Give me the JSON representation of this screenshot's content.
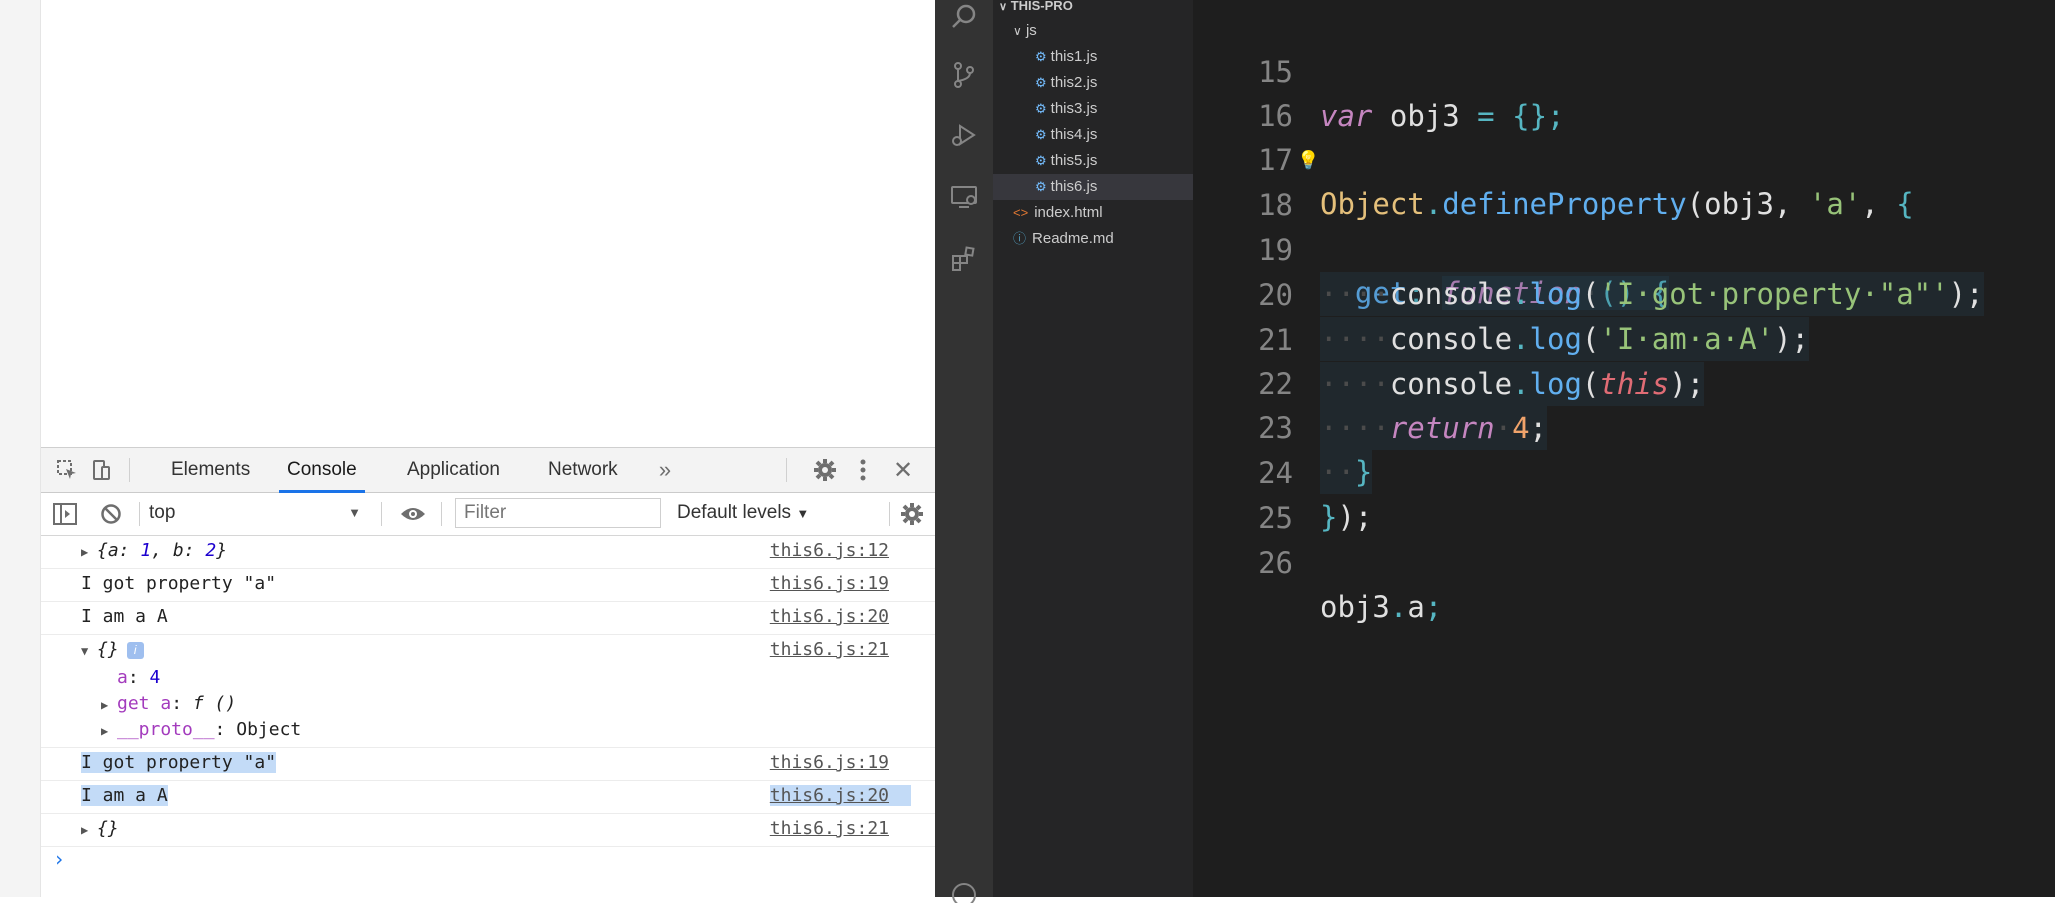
{
  "devtools": {
    "tabs": [
      "Elements",
      "Console",
      "Application",
      "Network"
    ],
    "more_tabs_icon": "chevron-double-right-icon",
    "context_select": "top",
    "filter_placeholder": "Filter",
    "levels_label": "Default levels",
    "console_rows": [
      {
        "source": "this6.js:12"
      },
      {
        "message": "I got property \"a\"",
        "source": "this6.js:19"
      },
      {
        "message": "I am a A",
        "source": "this6.js:20"
      },
      {
        "source": "this6.js:21"
      },
      {
        "message": "I got property \"a\"",
        "source": "this6.js:19"
      },
      {
        "message": "I am a A",
        "source": "this6.js:20"
      },
      {
        "source": "this6.js:21"
      }
    ],
    "object_preview": {
      "a": "1",
      "b": "2"
    },
    "expanded_props": {
      "a_value": "4",
      "getter_label": "get a",
      "getter_value": "f ()",
      "proto_label": "__proto__",
      "proto_value": "Object"
    },
    "colors": {
      "active_tab": "#1a73e8",
      "selection": "#c3dbf7"
    }
  },
  "vscode": {
    "explorer": {
      "folder": "THIS-PRO",
      "subfolder": "js",
      "files": [
        "this1.js",
        "this2.js",
        "this3.js",
        "this4.js",
        "this5.js",
        "this6.js"
      ],
      "root_files": [
        "index.html",
        "Readme.md"
      ],
      "selected": "this6.js"
    },
    "activity_icons": [
      "search-icon",
      "source-control-icon",
      "run-debug-icon",
      "remote-explorer-icon",
      "extensions-icon"
    ],
    "line_numbers": [
      "15",
      "16",
      "17",
      "18",
      "19",
      "20",
      "21",
      "22",
      "23",
      "24",
      "25",
      "26"
    ],
    "colors": {
      "editor_bg": "#1e1e1e",
      "sidebar_bg": "#252526",
      "activity_bg": "#333333"
    }
  }
}
